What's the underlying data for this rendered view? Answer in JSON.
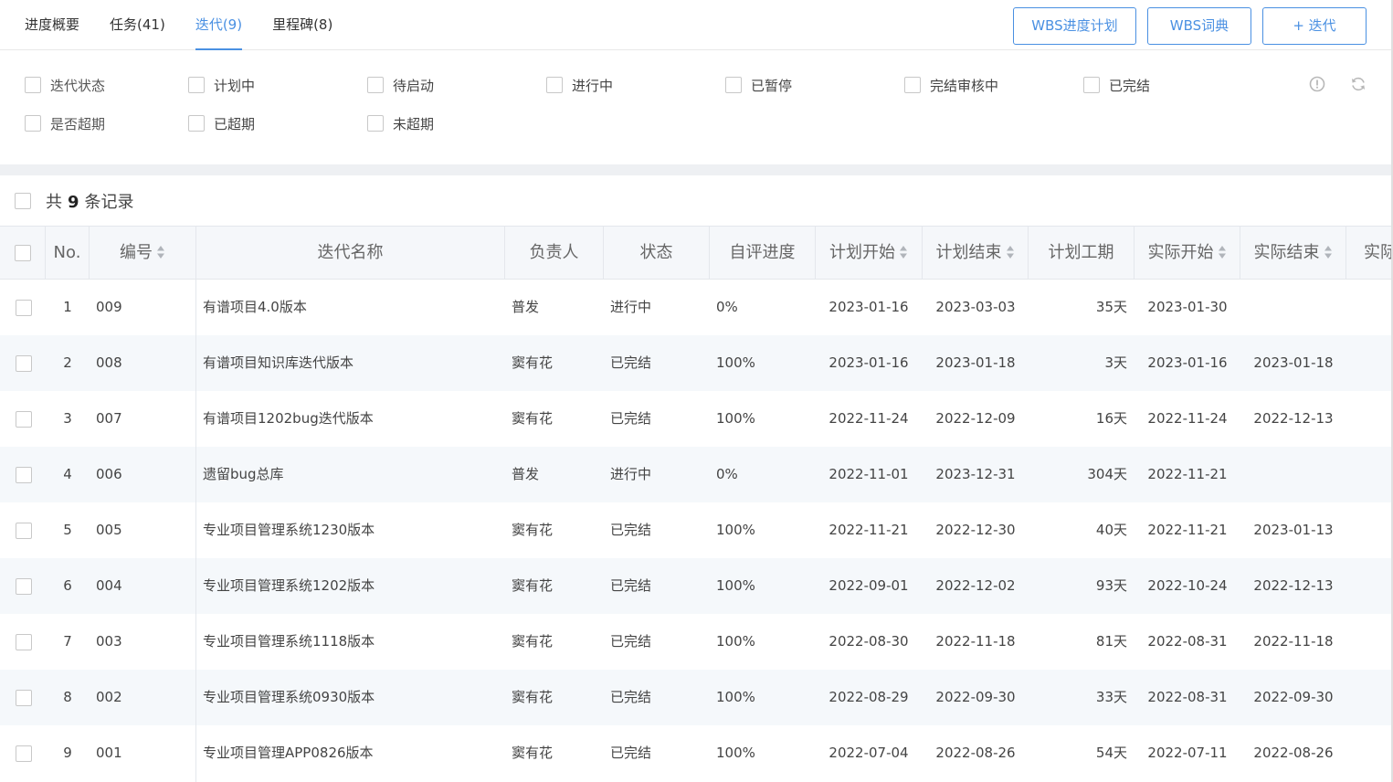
{
  "tabs": [
    {
      "label": "进度概要",
      "active": false
    },
    {
      "label": "任务(41)",
      "active": false
    },
    {
      "label": "迭代(9)",
      "active": true
    },
    {
      "label": "里程碑(8)",
      "active": false
    }
  ],
  "actions": {
    "wbs_plan": "WBS进度计划",
    "wbs_dict": "WBS词典",
    "add_iteration": "+ 迭代"
  },
  "filters": {
    "status_label": "迭代状态",
    "status_options": [
      "计划中",
      "待启动",
      "进行中",
      "已暂停",
      "完结审核中",
      "已完结"
    ],
    "overdue_label": "是否超期",
    "overdue_options": [
      "已超期",
      "未超期"
    ]
  },
  "toolbar_icons": [
    "info-icon",
    "refresh-icon"
  ],
  "records": {
    "prefix": "共",
    "count": "9",
    "suffix": "条记录"
  },
  "columns": {
    "no": "No.",
    "code": "编号",
    "name": "迭代名称",
    "owner": "负责人",
    "status": "状态",
    "progress": "自评进度",
    "plan_start": "计划开始",
    "plan_end": "计划结束",
    "plan_duration": "计划工期",
    "actual_start": "实际开始",
    "actual_end": "实际结束",
    "truncated": "实际"
  },
  "rows": [
    {
      "no": "1",
      "code": "009",
      "name": "有谱项目4.0版本",
      "owner": "普发",
      "status": "进行中",
      "progress": "0%",
      "plan_start": "2023-01-16",
      "plan_end": "2023-03-03",
      "plan_duration": "35天",
      "actual_start": "2023-01-30",
      "actual_end": ""
    },
    {
      "no": "2",
      "code": "008",
      "name": "有谱项目知识库迭代版本",
      "owner": "窦有花",
      "status": "已完结",
      "progress": "100%",
      "plan_start": "2023-01-16",
      "plan_end": "2023-01-18",
      "plan_duration": "3天",
      "actual_start": "2023-01-16",
      "actual_end": "2023-01-18"
    },
    {
      "no": "3",
      "code": "007",
      "name": "有谱项目1202bug迭代版本",
      "owner": "窦有花",
      "status": "已完结",
      "progress": "100%",
      "plan_start": "2022-11-24",
      "plan_end": "2022-12-09",
      "plan_duration": "16天",
      "actual_start": "2022-11-24",
      "actual_end": "2022-12-13"
    },
    {
      "no": "4",
      "code": "006",
      "name": "遗留bug总库",
      "owner": "普发",
      "status": "进行中",
      "progress": "0%",
      "plan_start": "2022-11-01",
      "plan_end": "2023-12-31",
      "plan_duration": "304天",
      "actual_start": "2022-11-21",
      "actual_end": ""
    },
    {
      "no": "5",
      "code": "005",
      "name": "专业项目管理系统1230版本",
      "owner": "窦有花",
      "status": "已完结",
      "progress": "100%",
      "plan_start": "2022-11-21",
      "plan_end": "2022-12-30",
      "plan_duration": "40天",
      "actual_start": "2022-11-21",
      "actual_end": "2023-01-13"
    },
    {
      "no": "6",
      "code": "004",
      "name": "专业项目管理系统1202版本",
      "owner": "窦有花",
      "status": "已完结",
      "progress": "100%",
      "plan_start": "2022-09-01",
      "plan_end": "2022-12-02",
      "plan_duration": "93天",
      "actual_start": "2022-10-24",
      "actual_end": "2022-12-13"
    },
    {
      "no": "7",
      "code": "003",
      "name": "专业项目管理系统1118版本",
      "owner": "窦有花",
      "status": "已完结",
      "progress": "100%",
      "plan_start": "2022-08-30",
      "plan_end": "2022-11-18",
      "plan_duration": "81天",
      "actual_start": "2022-08-31",
      "actual_end": "2022-11-18"
    },
    {
      "no": "8",
      "code": "002",
      "name": "专业项目管理系统0930版本",
      "owner": "窦有花",
      "status": "已完结",
      "progress": "100%",
      "plan_start": "2022-08-29",
      "plan_end": "2022-09-30",
      "plan_duration": "33天",
      "actual_start": "2022-08-31",
      "actual_end": "2022-09-30"
    },
    {
      "no": "9",
      "code": "001",
      "name": "专业项目管理APP0826版本",
      "owner": "窦有花",
      "status": "已完结",
      "progress": "100%",
      "plan_start": "2022-07-04",
      "plan_end": "2022-08-26",
      "plan_duration": "54天",
      "actual_start": "2022-07-11",
      "actual_end": "2022-08-26"
    }
  ],
  "colors": {
    "accent": "#4a90e2",
    "header_bg": "#f5f7fa",
    "stripe_bg": "#f5f8fb",
    "divider": "#eef0f3"
  }
}
